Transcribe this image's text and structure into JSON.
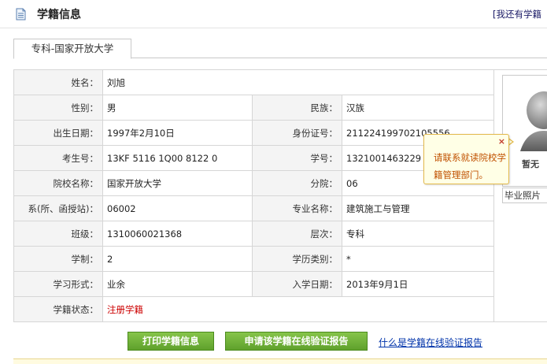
{
  "header": {
    "title": "学籍信息",
    "right_link": "[我还有学籍"
  },
  "tabs": [
    {
      "label": "专科-国家开放大学"
    }
  ],
  "record": {
    "name_label": "姓名：",
    "name": "刘旭",
    "gender_label": "性别：",
    "gender": "男",
    "ethnicity_label": "民族：",
    "ethnicity": "汉族",
    "birth_label": "出生日期：",
    "birth": "1997年2月10日",
    "id_label": "身份证号：",
    "id": "211224199702105556",
    "exam_no_label": "考生号：",
    "exam_no": "13KF 5116 1Q00 8122 0",
    "student_no_label": "学号：",
    "student_no": "1321001463229",
    "school_label": "院校名称：",
    "school": "国家开放大学",
    "branch_label": "分院：",
    "branch": "06",
    "dept_label": "系(所、函授站)：",
    "dept": "06002",
    "major_label": "专业名称：",
    "major": "建筑施工与管理",
    "class_label": "班级：",
    "class": "1310060021368",
    "level_label": "层次：",
    "level": "专科",
    "duration_label": "学制：",
    "duration": "2",
    "degree_type_label": "学历类别：",
    "degree_type": "*",
    "study_form_label": "学习形式：",
    "study_form": "业余",
    "enroll_date_label": "入学日期：",
    "enroll_date": "2013年9月1日",
    "status_label": "学籍状态：",
    "status": "注册学籍"
  },
  "photo": {
    "placeholder_text": "暂无",
    "caption": "毕业照片"
  },
  "tooltip": {
    "text": "请联系就读院校学籍管理部门。",
    "close_glyph": "×"
  },
  "actions": {
    "print_label": "打印学籍信息",
    "apply_label": "申请该学籍在线验证报告",
    "what_is_link": "什么是学籍在线验证报告"
  },
  "colors": {
    "button_green": "#5fa12c",
    "status_red": "#cc0000",
    "tooltip_text": "#c05000",
    "link_blue": "#0033aa"
  }
}
